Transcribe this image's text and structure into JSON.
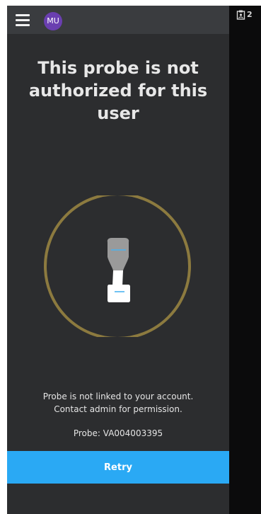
{
  "app_bar": {
    "avatar_initials": "MU",
    "menu_icon": "hamburger-menu-icon"
  },
  "status_bar": {
    "icon": "clipboard-user-icon",
    "count": "2"
  },
  "main": {
    "title": "This probe is not authorized for this user",
    "illustration": "probe-in-circle",
    "message_line1": "Probe is not linked to your account.",
    "message_line2": "Contact admin for permission.",
    "probe_id_text": "Probe: VA004003395"
  },
  "actions": {
    "retry_label": "Retry"
  },
  "colors": {
    "panel_bg": "#2c2d2f",
    "app_bar_bg": "#3a3c3f",
    "avatar_bg": "#6a3fb0",
    "ring": "#8c7a3f",
    "accent_blue": "#2aa9f4",
    "right_bg": "#0b0b0c"
  }
}
